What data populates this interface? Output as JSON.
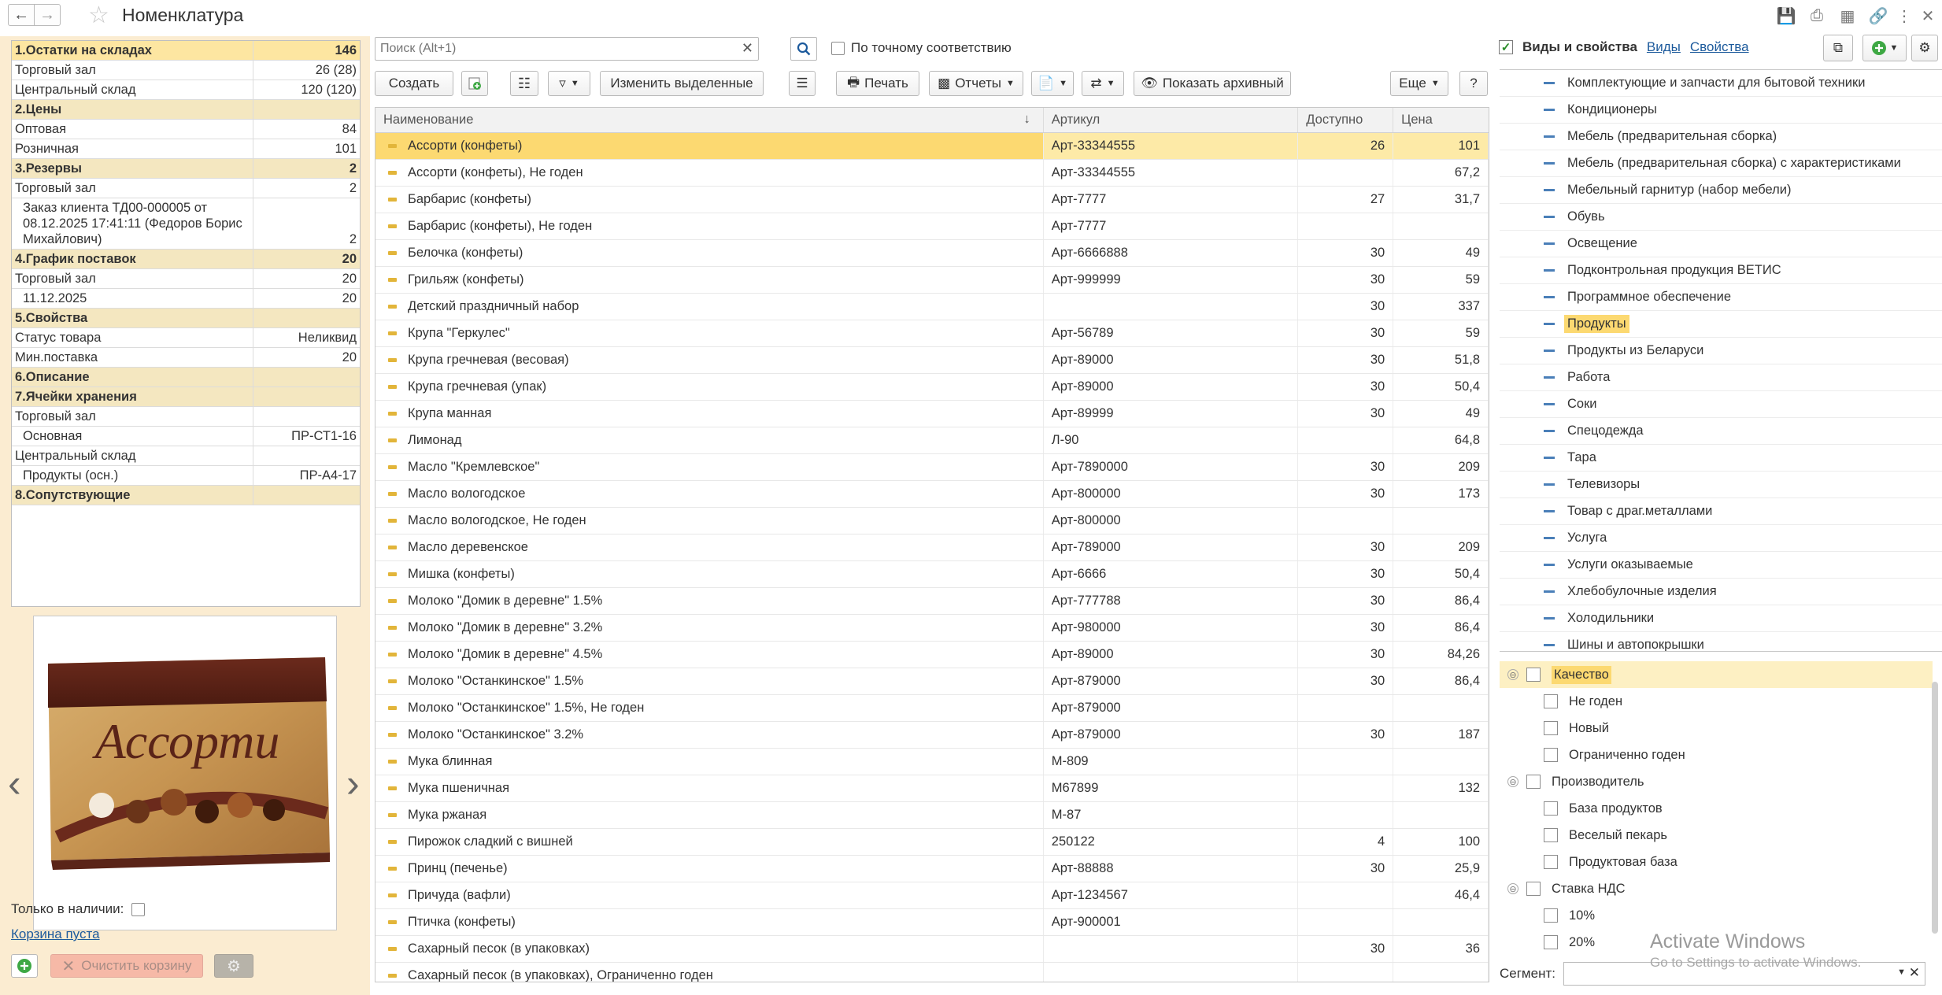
{
  "title": "Номенклатура",
  "left": {
    "props": [
      {
        "label": "1.Остатки на складах",
        "value": "146",
        "type": "sec"
      },
      {
        "label": "Торговый зал",
        "value": "26 (28)",
        "type": "row"
      },
      {
        "label": "Центральный склад",
        "value": "120 (120)",
        "type": "row"
      },
      {
        "label": "2.Цены",
        "value": "",
        "type": "sec"
      },
      {
        "label": "Оптовая",
        "value": "84",
        "type": "row"
      },
      {
        "label": "Розничная",
        "value": "101",
        "type": "row"
      },
      {
        "label": "3.Резервы",
        "value": "2",
        "type": "sec"
      },
      {
        "label": "Торговый зал",
        "value": "2",
        "type": "row"
      },
      {
        "label": "Заказ клиента ТД00-000005 от 08.12.2025 17:41:11 (Федоров Борис Михайлович)",
        "value": "2",
        "type": "ind"
      },
      {
        "label": "4.График поставок",
        "value": "20",
        "type": "sec"
      },
      {
        "label": "Торговый зал",
        "value": "20",
        "type": "row"
      },
      {
        "label": "11.12.2025",
        "value": "20",
        "type": "ind"
      },
      {
        "label": "5.Свойства",
        "value": "",
        "type": "sec"
      },
      {
        "label": "Статус товара",
        "value": "Неликвид",
        "type": "row"
      },
      {
        "label": "Мин.поставка",
        "value": "20",
        "type": "row"
      },
      {
        "label": "6.Описание",
        "value": "",
        "type": "sec"
      },
      {
        "label": "7.Ячейки хранения",
        "value": "",
        "type": "sec"
      },
      {
        "label": "Торговый зал",
        "value": "",
        "type": "row"
      },
      {
        "label": "Основная",
        "value": "ПР-СТ1-16",
        "type": "ind"
      },
      {
        "label": "Центральный склад",
        "value": "",
        "type": "row"
      },
      {
        "label": "Продукты (осн.)",
        "value": "ПР-А4-17",
        "type": "ind"
      },
      {
        "label": "8.Сопутствующие",
        "value": "",
        "type": "sec"
      }
    ],
    "image_brand": "Ассорти",
    "only_in_stock_label": "Только в наличии:",
    "cart_link": "Корзина пуста",
    "clear_cart_label": "Очистить корзину"
  },
  "search": {
    "placeholder": "Поиск (Alt+1)",
    "exact_label": "По точному соответствию"
  },
  "toolbar": {
    "create": "Создать",
    "change_selected": "Изменить выделенные",
    "print": "Печать",
    "reports": "Отчеты",
    "show_archive": "Показать архивный",
    "more": "Еще",
    "help": "?"
  },
  "grid": {
    "headers": {
      "name": "Наименование",
      "article": "Артикул",
      "available": "Доступно",
      "price": "Цена"
    },
    "rows": [
      {
        "name": "Ассорти (конфеты)",
        "article": "Арт-33344555",
        "qty": "26",
        "price": "101"
      },
      {
        "name": "Ассорти (конфеты), Не годен",
        "article": "Арт-33344555",
        "qty": "",
        "price": "67,2"
      },
      {
        "name": "Барбарис (конфеты)",
        "article": "Арт-7777",
        "qty": "27",
        "price": "31,7"
      },
      {
        "name": "Барбарис (конфеты), Не годен",
        "article": "Арт-7777",
        "qty": "",
        "price": ""
      },
      {
        "name": "Белочка (конфеты)",
        "article": "Арт-6666888",
        "qty": "30",
        "price": "49"
      },
      {
        "name": "Грильяж (конфеты)",
        "article": "Арт-999999",
        "qty": "30",
        "price": "59"
      },
      {
        "name": "Детский праздничный набор",
        "article": "",
        "qty": "30",
        "price": "337"
      },
      {
        "name": "Крупа \"Геркулес\"",
        "article": "Арт-56789",
        "qty": "30",
        "price": "59"
      },
      {
        "name": "Крупа гречневая (весовая)",
        "article": "Арт-89000",
        "qty": "30",
        "price": "51,8"
      },
      {
        "name": "Крупа гречневая (упак)",
        "article": "Арт-89000",
        "qty": "30",
        "price": "50,4"
      },
      {
        "name": "Крупа манная",
        "article": "Арт-89999",
        "qty": "30",
        "price": "49"
      },
      {
        "name": "Лимонад",
        "article": "Л-90",
        "qty": "",
        "price": "64,8"
      },
      {
        "name": "Масло \"Кремлевское\"",
        "article": "Арт-7890000",
        "qty": "30",
        "price": "209"
      },
      {
        "name": "Масло вологодское",
        "article": "Арт-800000",
        "qty": "30",
        "price": "173"
      },
      {
        "name": "Масло вологодское, Не годен",
        "article": "Арт-800000",
        "qty": "",
        "price": ""
      },
      {
        "name": "Масло деревенское",
        "article": "Арт-789000",
        "qty": "30",
        "price": "209"
      },
      {
        "name": "Мишка (конфеты)",
        "article": "Арт-6666",
        "qty": "30",
        "price": "50,4"
      },
      {
        "name": "Молоко \"Домик в деревне\" 1.5%",
        "article": "Арт-777788",
        "qty": "30",
        "price": "86,4"
      },
      {
        "name": "Молоко \"Домик в деревне\" 3.2%",
        "article": "Арт-980000",
        "qty": "30",
        "price": "86,4"
      },
      {
        "name": "Молоко \"Домик в деревне\" 4.5%",
        "article": "Арт-89000",
        "qty": "30",
        "price": "84,26"
      },
      {
        "name": "Молоко \"Останкинское\" 1.5%",
        "article": "Арт-879000",
        "qty": "30",
        "price": "86,4"
      },
      {
        "name": "Молоко \"Останкинское\" 1.5%, Не годен",
        "article": "Арт-879000",
        "qty": "",
        "price": ""
      },
      {
        "name": "Молоко \"Останкинское\" 3.2%",
        "article": "Арт-879000",
        "qty": "30",
        "price": "187"
      },
      {
        "name": "Мука блинная",
        "article": "М-809",
        "qty": "",
        "price": ""
      },
      {
        "name": "Мука пшеничная",
        "article": "М67899",
        "qty": "",
        "price": "132"
      },
      {
        "name": "Мука ржаная",
        "article": "М-87",
        "qty": "",
        "price": ""
      },
      {
        "name": "Пирожок сладкий с вишней",
        "article": "250122",
        "qty": "4",
        "price": "100"
      },
      {
        "name": "Принц (печенье)",
        "article": "Арт-88888",
        "qty": "30",
        "price": "25,9"
      },
      {
        "name": "Причуда (вафли)",
        "article": "Арт-1234567",
        "qty": "",
        "price": "46,4"
      },
      {
        "name": "Птичка (конфеты)",
        "article": "Арт-900001",
        "qty": "",
        "price": ""
      },
      {
        "name": "Сахарный песок (в упаковках)",
        "article": "",
        "qty": "30",
        "price": "36"
      },
      {
        "name": "Сахарный песок (в упаковках), Ограниченно годен",
        "article": "",
        "qty": "",
        "price": ""
      }
    ]
  },
  "right": {
    "header": "Виды и свойства",
    "link_kinds": "Виды",
    "link_props": "Свойства",
    "kinds": [
      "Комплектующие и запчасти для бытовой техники",
      "Кондиционеры",
      "Мебель (предварительная сборка)",
      "Мебель (предварительная сборка) с характеристиками",
      "Мебельный гарнитур (набор мебели)",
      "Обувь",
      "Освещение",
      "Подконтрольная продукция ВЕТИС",
      "Программное обеспечение",
      "Продукты",
      "Продукты из Беларуси",
      "Работа",
      "Соки",
      "Спецодежда",
      "Тара",
      "Телевизоры",
      "Товар с драг.металлами",
      "Услуга",
      "Услуги оказываемые",
      "Хлебобулочные изделия",
      "Холодильники",
      "Шины и автопокрышки"
    ],
    "properties": [
      {
        "label": "Качество",
        "type": "grp"
      },
      {
        "label": "Не годен",
        "type": "child"
      },
      {
        "label": "Новый",
        "type": "child"
      },
      {
        "label": "Ограниченно годен",
        "type": "child"
      },
      {
        "label": "Производитель",
        "type": "grp"
      },
      {
        "label": "База продуктов",
        "type": "child"
      },
      {
        "label": "Веселый пекарь",
        "type": "child"
      },
      {
        "label": "Продуктовая база",
        "type": "child"
      },
      {
        "label": "Ставка НДС",
        "type": "grp"
      },
      {
        "label": "10%",
        "type": "child"
      },
      {
        "label": "20%",
        "type": "child"
      }
    ],
    "segment_label": "Сегмент:"
  },
  "watermark": {
    "line1": "Activate Windows",
    "line2": "Go to Settings to activate Windows."
  }
}
